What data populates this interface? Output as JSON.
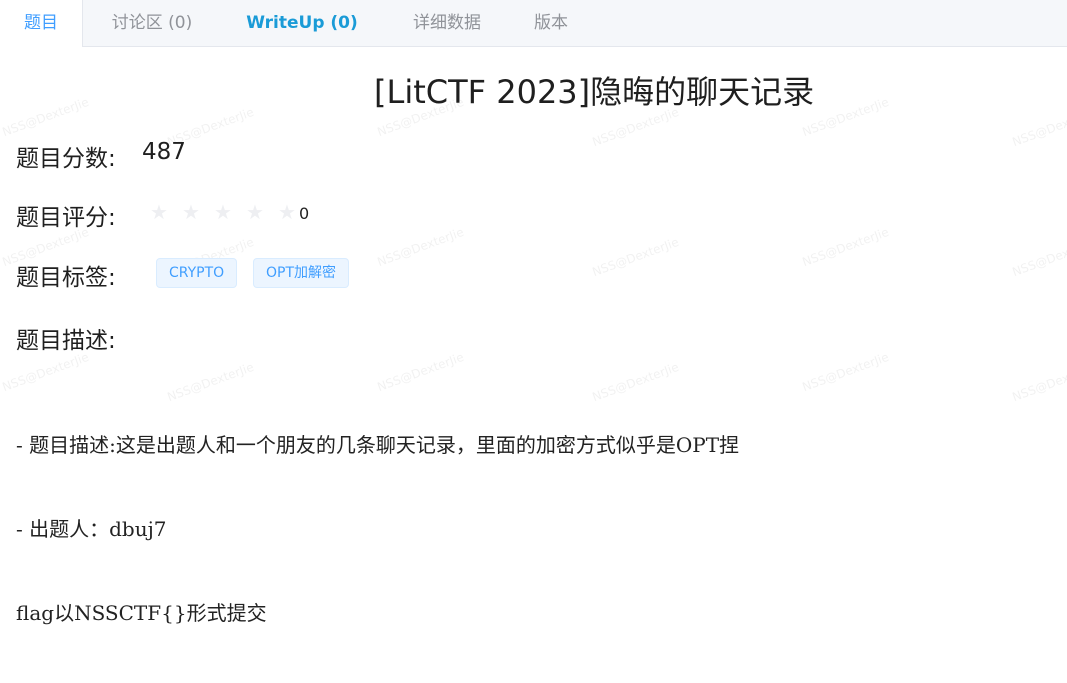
{
  "tabs": [
    {
      "label": "题目",
      "active": true
    },
    {
      "label": "讨论区 (0)",
      "active": false
    },
    {
      "label": "WriteUp (0)",
      "active": false
    },
    {
      "label": "详细数据",
      "active": false
    },
    {
      "label": "版本",
      "active": false
    }
  ],
  "problem": {
    "title": "[LitCTF 2023]隐晦的聊天记录",
    "score_label": "题目分数:",
    "score_value": "487",
    "rating_label": "题目评分:",
    "rating_value": "0",
    "rating_stars_filled": 0,
    "rating_stars_total": 5,
    "tags_label": "题目标签:",
    "tags": [
      "CRYPTO",
      "OPT加解密"
    ],
    "description_label": "题目描述:",
    "description_lines": [
      "- 题目描述:这是出题人和一个朋友的几条聊天记录，里面的加密方式似乎是OPT捏",
      "- 出题人：dbuj7",
      "flag以NSSCTF{}形式提交"
    ]
  },
  "watermark": "NSS@DexterJie",
  "colors": {
    "accent": "#409eff",
    "writeup": "#1a9bd7",
    "tag_bg": "#ecf5ff",
    "star_empty": "#eeeff2"
  }
}
